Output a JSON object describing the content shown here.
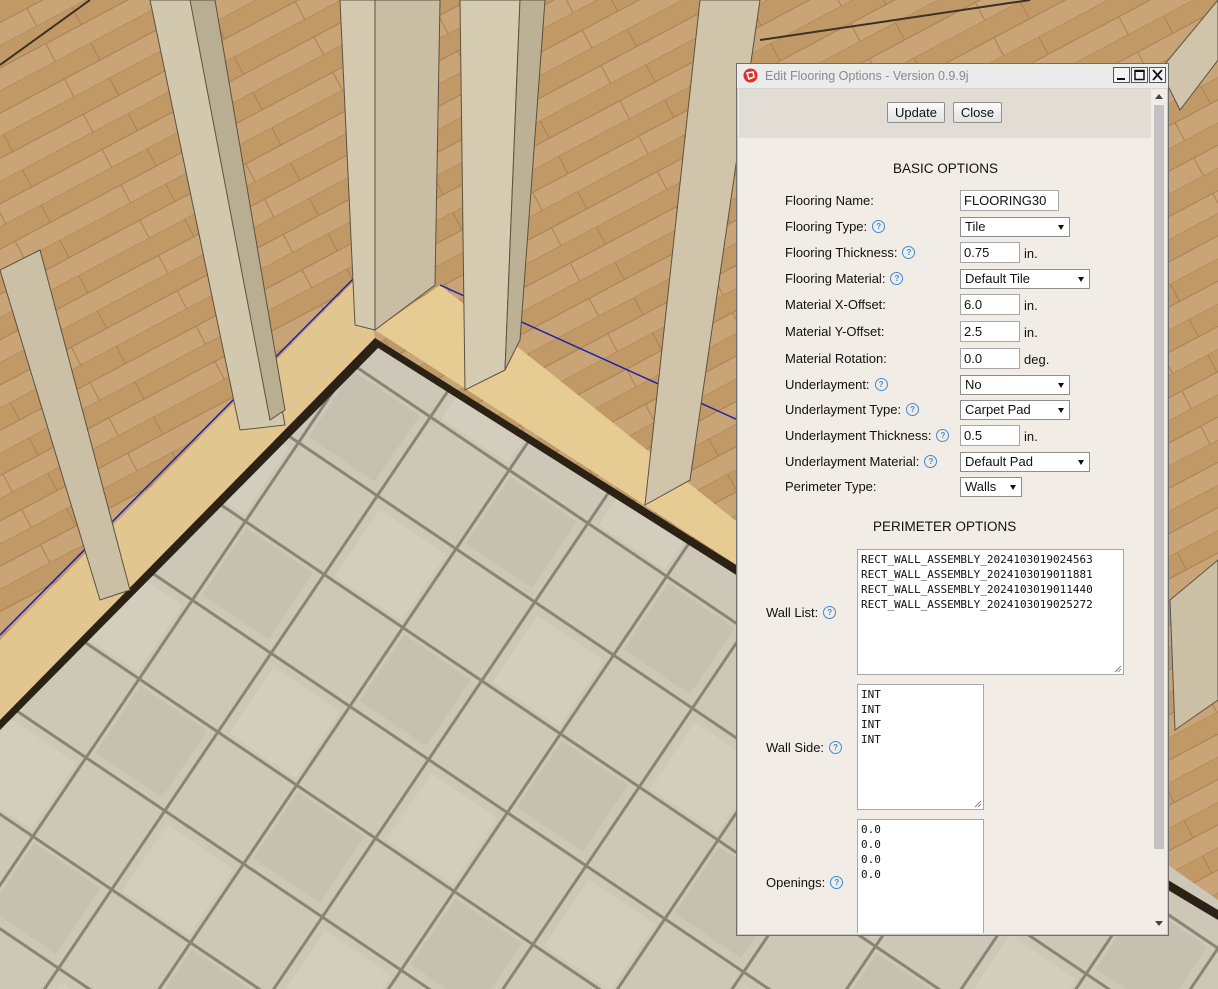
{
  "window": {
    "title": "Edit Flooring Options - Version 0.9.9j"
  },
  "toolbar": {
    "update_label": "Update",
    "close_label": "Close"
  },
  "basic": {
    "section_title": "BASIC OPTIONS",
    "flooring_name_label": "Flooring Name:",
    "flooring_name_value": "FLOORING30",
    "flooring_type_label": "Flooring Type:",
    "flooring_type_value": "Tile",
    "flooring_thickness_label": "Flooring Thickness:",
    "flooring_thickness_value": "0.75",
    "flooring_thickness_unit": "in.",
    "flooring_material_label": "Flooring Material:",
    "flooring_material_value": "Default Tile",
    "x_offset_label": "Material X-Offset:",
    "x_offset_value": "6.0",
    "x_offset_unit": "in.",
    "y_offset_label": "Material Y-Offset:",
    "y_offset_value": "2.5",
    "y_offset_unit": "in.",
    "rotation_label": "Material Rotation:",
    "rotation_value": "0.0",
    "rotation_unit": "deg.",
    "underlayment_label": "Underlayment:",
    "underlayment_value": "No",
    "underlayment_type_label": "Underlayment Type:",
    "underlayment_type_value": "Carpet Pad",
    "underlayment_thickness_label": "Underlayment Thickness:",
    "underlayment_thickness_value": "0.5",
    "underlayment_thickness_unit": "in.",
    "underlayment_material_label": "Underlayment Material:",
    "underlayment_material_value": "Default Pad",
    "perimeter_type_label": "Perimeter Type:",
    "perimeter_type_value": "Walls"
  },
  "perimeter": {
    "section_title": "PERIMETER OPTIONS",
    "wall_list_label": "Wall List:",
    "wall_list_value": "RECT_WALL_ASSEMBLY_2024103019024563\nRECT_WALL_ASSEMBLY_2024103019011881\nRECT_WALL_ASSEMBLY_2024103019011440\nRECT_WALL_ASSEMBLY_2024103019025272",
    "wall_side_label": "Wall Side:",
    "wall_side_value": "INT\nINT\nINT\nINT",
    "openings_label": "Openings:",
    "openings_value": "0.0\n0.0\n0.0\n0.0"
  },
  "icons": {
    "app": "sketchup-icon",
    "help": "help-icon",
    "minimize": "minimize-icon",
    "maximize": "maximize-icon",
    "close": "close-icon"
  },
  "colors": {
    "dialog_bg": "#f1ede6",
    "topbar_bg": "#e2ddd4",
    "help_blue": "#3d8ad6",
    "tile": "#c9c3b3",
    "wood_floor": "#c49a6a",
    "stud": "#cfc5ad"
  }
}
